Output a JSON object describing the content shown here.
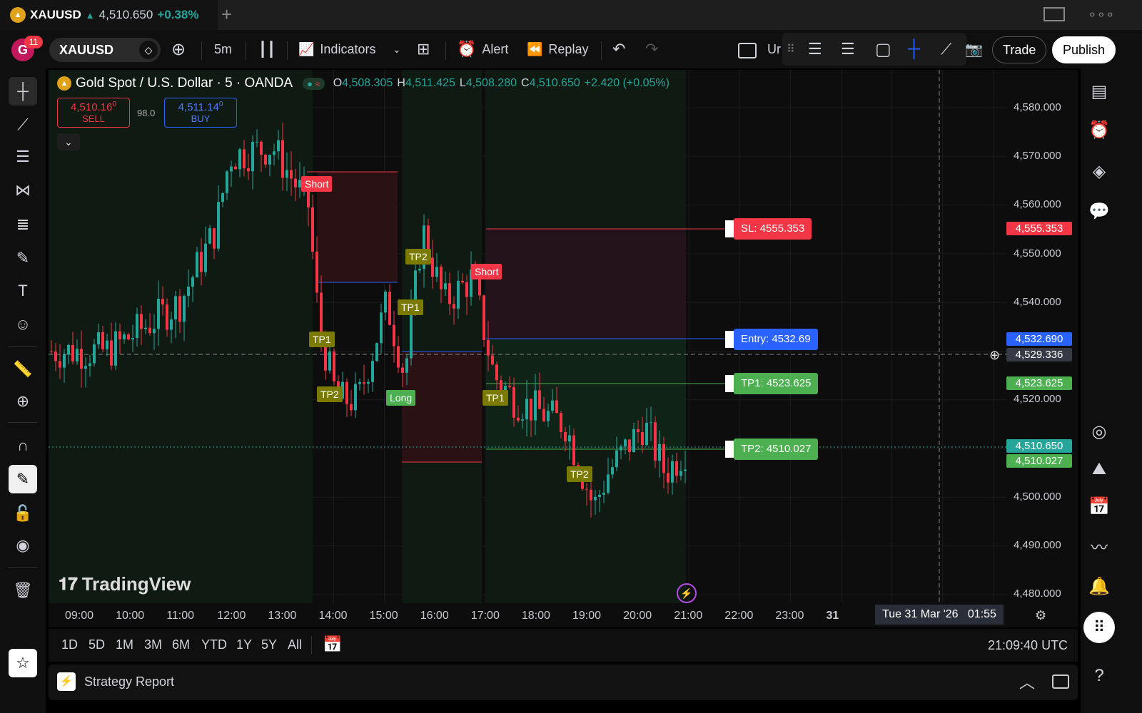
{
  "tab": {
    "symbol": "XAUUSD",
    "price": "4,510.650",
    "change": "+0.38%",
    "new_tab": "+"
  },
  "toolbar": {
    "avatar_letter": "G",
    "notifications": "11",
    "symbol": "XAUUSD",
    "interval": "5m",
    "indicators": "Indicators",
    "alert": "Alert",
    "replay": "Replay",
    "unnamed": "Ur",
    "trade": "Trade",
    "publish": "Publish"
  },
  "legend": {
    "title": "Gold Spot / U.S. Dollar · 5 · OANDA",
    "o_label": "O",
    "o_value": "4,508.305",
    "h_label": "H",
    "h_value": "4,511.425",
    "l_label": "L",
    "l_value": "4,508.280",
    "c_label": "C",
    "c_value": "4,510.650",
    "change": "+2.420 (+0.05%)"
  },
  "trade_widget": {
    "sell_price": "4,510.16",
    "sell_sup": "0",
    "sell_label": "SELL",
    "spread": "98.0",
    "buy_price": "4,511.14",
    "buy_sup": "0",
    "buy_label": "BUY"
  },
  "price_axis": [
    "4,580.000",
    "4,570.000",
    "4,560.000",
    "4,550.000",
    "4,540.000",
    "4,530.000",
    "4,520.000",
    "4,510.000",
    "4,500.000",
    "4,490.000",
    "4,480.000"
  ],
  "price_labels": {
    "sl": "4,555.353",
    "entry": "4,532.690",
    "crosshair": "4,529.336",
    "tp1": "4,523.625",
    "last": "4,510.650",
    "tp2": "4,510.027"
  },
  "flags": {
    "sl": "SL: 4555.353",
    "entry": "Entry: 4532.69",
    "tp1": "TP1: 4523.625",
    "tp2": "TP2: 4510.027"
  },
  "marks": {
    "short": "Short",
    "long": "Long",
    "tp1": "TP1",
    "tp2": "TP2"
  },
  "time_axis": [
    "09:00",
    "10:00",
    "11:00",
    "12:00",
    "13:00",
    "14:00",
    "15:00",
    "16:00",
    "17:00",
    "18:00",
    "19:00",
    "20:00",
    "21:00",
    "22:00",
    "23:00",
    "31"
  ],
  "crosshair_time": "Tue 31 Mar '26   01:55",
  "watermark": "TradingView",
  "ranges": [
    "1D",
    "5D",
    "1M",
    "3M",
    "6M",
    "YTD",
    "1Y",
    "5Y",
    "All"
  ],
  "clock": "21:09:40 UTC",
  "strategy_report": "Strategy Report",
  "colors": {
    "up": "#26a69a",
    "down": "#f23645",
    "sl": "#f23645",
    "entry": "#2962ff",
    "tp": "#4caf50",
    "mark": "#7a7a00"
  }
}
